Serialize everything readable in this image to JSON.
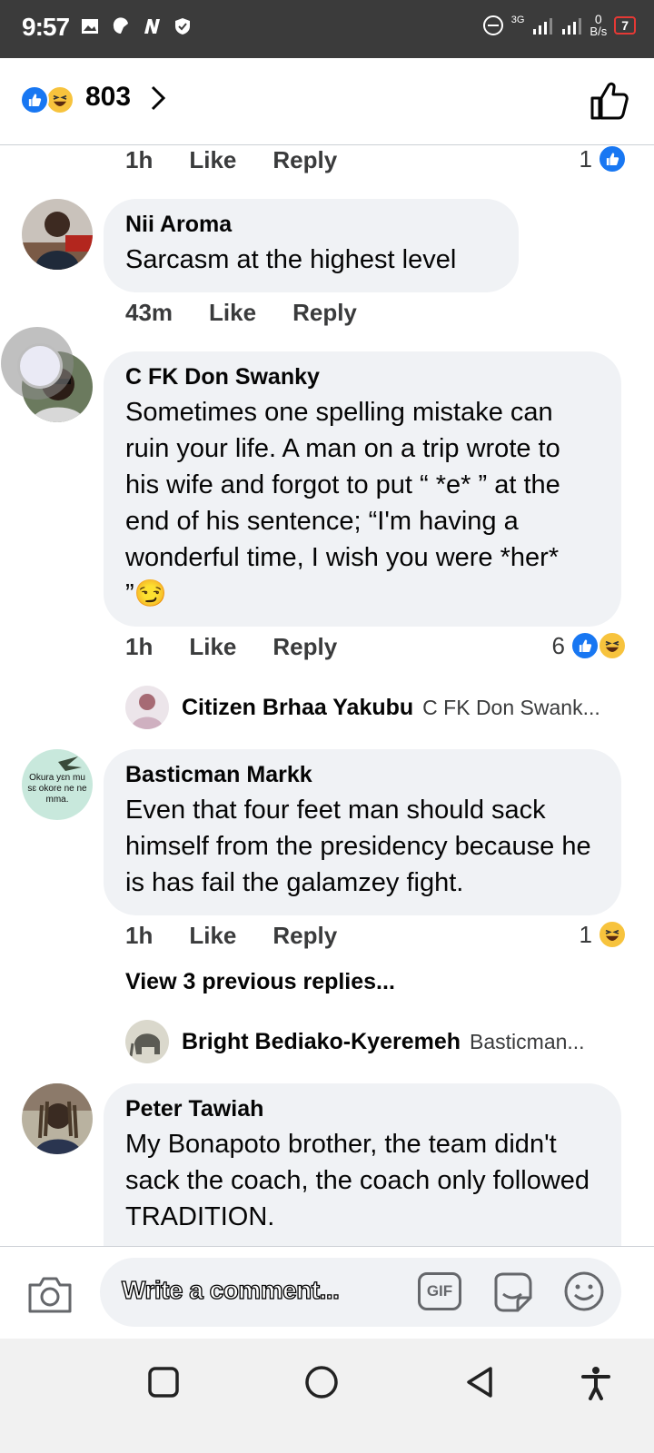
{
  "status_bar": {
    "time": "9:57",
    "network": "3G",
    "data_rate_value": "0",
    "data_rate_unit": "B/s",
    "battery": "7"
  },
  "header": {
    "reaction_count": "803"
  },
  "top_actions": {
    "time": "1h",
    "like": "Like",
    "reply": "Reply",
    "reaction_count": "1"
  },
  "comments": [
    {
      "name": "Nii Aroma",
      "text": "Sarcasm at the highest level",
      "time": "43m",
      "like": "Like",
      "reply": "Reply"
    },
    {
      "name": "C FK Don Swanky",
      "text": "Sometimes one spelling mistake can ruin your life. A man on a trip wrote to his wife and forgot to put “ *e* ” at the end of his sentence; “I'm having a wonderful time, I wish you were *her* ”😏",
      "time": "1h",
      "like": "Like",
      "reply": "Reply",
      "reaction_count": "6",
      "reply_preview": {
        "name": "Citizen Brhaa Yakubu",
        "text": "C FK Don Swank..."
      }
    },
    {
      "name": "Basticman Markk",
      "text": "Even that four feet man should sack himself from the presidency because he is has fail the galamzey fight.",
      "time": "1h",
      "like": "Like",
      "reply": "Reply",
      "reaction_count": "1",
      "avatar_text": "Okura yɛn mu sɛ okore ne ne mma.",
      "view_previous": "View 3 previous replies...",
      "reply_preview": {
        "name": "Bright Bediako-Kyeremeh",
        "text": "Basticman..."
      }
    },
    {
      "name": "Peter Tawiah",
      "text": "My Bonapoto brother, the team didn't sack the coach, the coach only followed TRADITION."
    }
  ],
  "composer": {
    "placeholder": "Write a comment...",
    "gif_label": "GIF"
  },
  "colors": {
    "like_blue": "#1877f2",
    "haha_yellow": "#f7c33d",
    "bubble_bg": "#f0f2f5"
  }
}
